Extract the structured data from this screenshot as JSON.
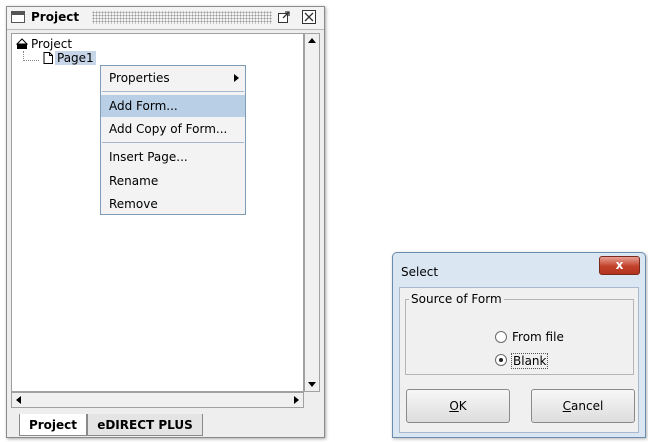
{
  "project_panel": {
    "title": "Project",
    "tree": {
      "root_label": "Project",
      "child_label": "Page1"
    },
    "tabs": [
      "Project",
      "eDIRECT PLUS"
    ]
  },
  "context_menu": {
    "items": {
      "properties": "Properties",
      "add_form": "Add Form...",
      "add_copy_of_form": "Add Copy of Form...",
      "insert_page": "Insert Page...",
      "rename": "Rename",
      "remove": "Remove"
    }
  },
  "dialog": {
    "title": "Select",
    "close_label": "x",
    "group_label": "Source of Form",
    "options": [
      "From file",
      "Blank"
    ],
    "selected_option": "Blank",
    "ok": {
      "mnemonic": "O",
      "rest": "K"
    },
    "cancel": {
      "mnemonic": "C",
      "rest": "ancel"
    }
  },
  "colors": {
    "selection": "#c7d5e8",
    "menu_highlight": "#b8cfe5",
    "close_button": "#c2402a"
  }
}
